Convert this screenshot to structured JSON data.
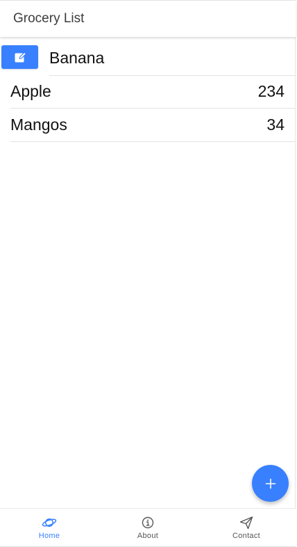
{
  "header": {
    "title": "Grocery List"
  },
  "items": [
    {
      "name": "Banana",
      "quantity": ""
    },
    {
      "name": "Apple",
      "quantity": "234"
    },
    {
      "name": "Mangos",
      "quantity": "34"
    }
  ],
  "fab": {
    "icon": "plus-icon"
  },
  "tabs": [
    {
      "label": "Home",
      "icon": "planet-icon",
      "active": true
    },
    {
      "label": "About",
      "icon": "info-icon",
      "active": false
    },
    {
      "label": "Contact",
      "icon": "paper-plane-icon",
      "active": false
    }
  ],
  "colors": {
    "accent": "#3880ff",
    "text": "#111111",
    "tab_inactive": "#555555",
    "divider": "#e2e2e2"
  }
}
